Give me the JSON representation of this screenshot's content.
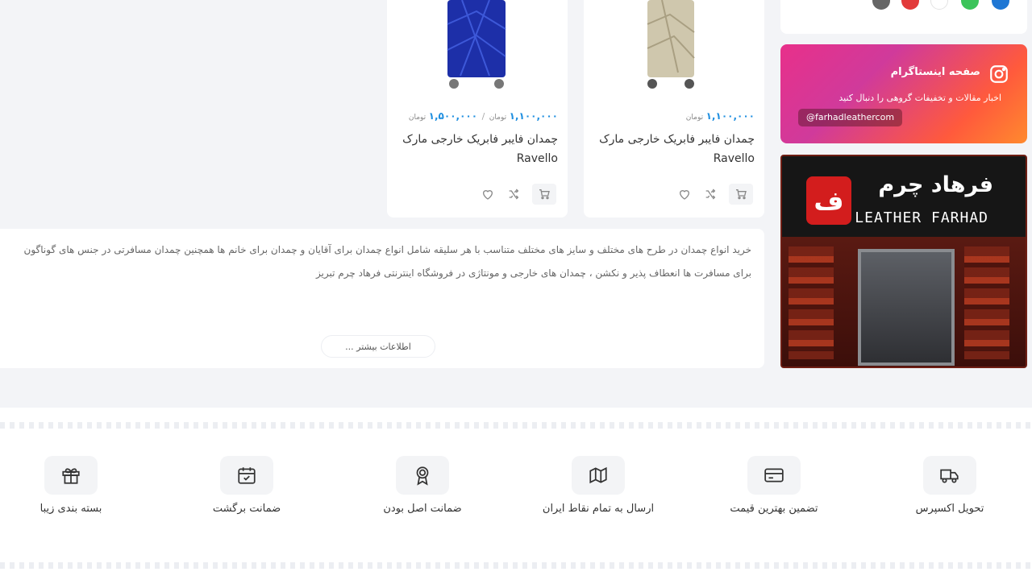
{
  "products": [
    {
      "title": "چمدان فایبر فابریک خارجی مارک",
      "title_latin": "Ravello",
      "price": "۱,۱۰۰,۰۰۰",
      "currency": "تومان"
    },
    {
      "title": "چمدان فایبر فابریک خارجی مارک",
      "title_latin": "Ravello",
      "price": "۱,۱۰۰,۰۰۰",
      "currency": "تومان",
      "old_price": "۱,۵۰۰,۰۰۰",
      "old_currency": "تومان",
      "separator": "/"
    }
  ],
  "description": {
    "text": "خرید انواع چمدان در طرح های مختلف و سایز های مختلف متناسب با هر سلیقه شامل انواع چمدان برای آقایان و چمدان برای خانم ها همچنین چمدان مسافرتی در جنس های گوناگون برای مسافرت ها انعطاف پذیر و نکشن ، چمدان های خارجی و مونتاژی در فروشگاه اینترنتی فرهاد چرم تبریز",
    "more_button": "اطلاعات بیشتر ..."
  },
  "instagram": {
    "title": "صفحه اینستاگرام",
    "subtitle": "اخبار مقالات و تخفیفات گروهی را دنبال کنید",
    "handle": "@farhadleathercom"
  },
  "store_banner": {
    "sign_fa": "فرهاد چرم",
    "sign_en": "LEATHER FARHAD",
    "logo_glyph": "ف"
  },
  "swatches": [
    "#1f77d4",
    "#3cc45a",
    "#ffffff",
    "#e23a3a",
    "#666666"
  ],
  "features": [
    {
      "label": "تحویل اکسپرس",
      "icon": "truck-icon"
    },
    {
      "label": "تضمین بهترین قیمت",
      "icon": "credit-card-icon"
    },
    {
      "label": "ارسال به تمام نقاط ایران",
      "icon": "map-icon"
    },
    {
      "label": "ضمانت اصل بودن",
      "icon": "award-icon"
    },
    {
      "label": "ضمانت برگشت",
      "icon": "calendar-check-icon"
    },
    {
      "label": "بسته بندی زیبا",
      "icon": "gift-icon"
    }
  ]
}
